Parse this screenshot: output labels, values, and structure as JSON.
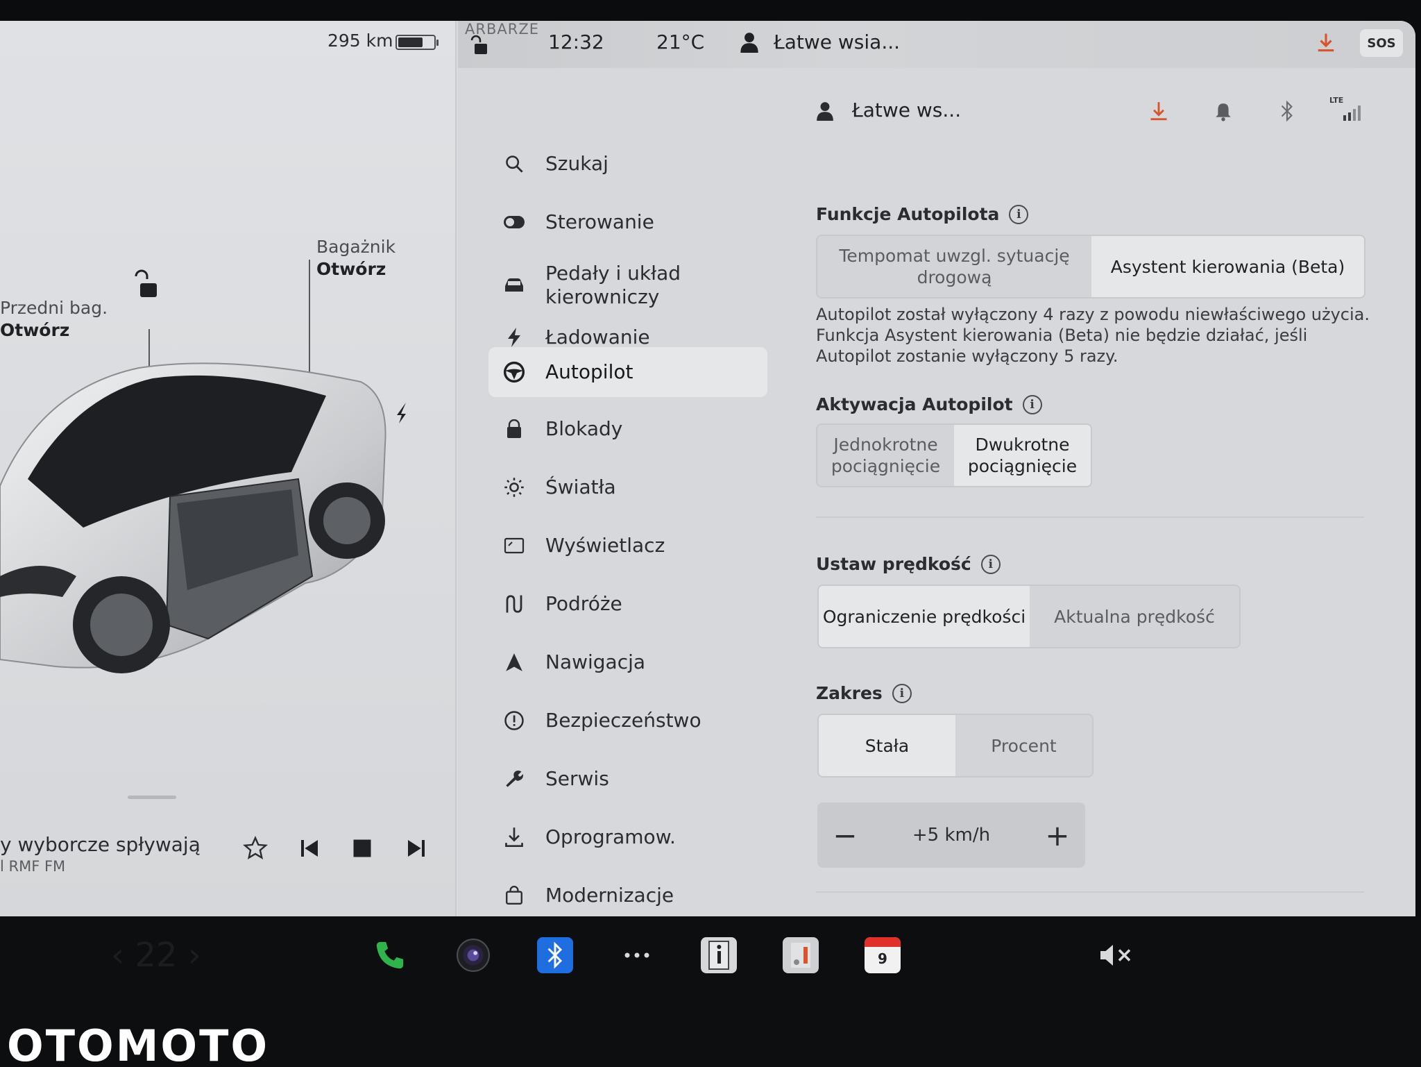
{
  "status": {
    "range": "295 km",
    "battery_level": 0.7,
    "map_label": "ARBARZE",
    "time": "12:32",
    "temperature": "21°C",
    "profile": "Łatwe wsia...",
    "sos_label": "SOS"
  },
  "car": {
    "front_trunk_label": "Przedni bag.",
    "front_trunk_action": "Otwórz",
    "trunk_label": "Bagażnik",
    "trunk_action": "Otwórz"
  },
  "media": {
    "title": "y wyborcze spływają",
    "station": "l RMF FM"
  },
  "nav": {
    "items": [
      {
        "label": "Szukaj",
        "icon": "search-icon"
      },
      {
        "label": "Sterowanie",
        "icon": "toggle-icon"
      },
      {
        "label": "Pedały i układ kierowniczy",
        "icon": "car-icon"
      },
      {
        "label": "Ładowanie",
        "icon": "bolt-icon"
      },
      {
        "label": "Autopilot",
        "icon": "steering-wheel-icon"
      },
      {
        "label": "Blokady",
        "icon": "lock-icon"
      },
      {
        "label": "Światła",
        "icon": "sun-icon"
      },
      {
        "label": "Wyświetlacz",
        "icon": "display-icon"
      },
      {
        "label": "Podróże",
        "icon": "trips-icon"
      },
      {
        "label": "Nawigacja",
        "icon": "navigation-icon"
      },
      {
        "label": "Bezpieczeństwo",
        "icon": "alert-icon"
      },
      {
        "label": "Serwis",
        "icon": "wrench-icon"
      },
      {
        "label": "Oprogramow.",
        "icon": "download-icon"
      },
      {
        "label": "Modernizacje",
        "icon": "bag-icon"
      }
    ],
    "active_index": 4
  },
  "content": {
    "profile_name": "Łatwe ws...",
    "signal_label": "LTE",
    "autopilot_features": {
      "title": "Funkcje Autopilota",
      "options": [
        "Tempomat uwzgl. sytuację drogową",
        "Asystent kierowania (Beta)"
      ],
      "selected": 1
    },
    "warning": "Autopilot został wyłączony 4 razy z powodu niewłaściwego użycia. Funkcja Asystent kierowania (Beta) nie będzie działać, jeśli Autopilot zostanie wyłączony 5 razy.",
    "activation": {
      "title": "Aktywacja Autopilot",
      "options": [
        "Jednokrotne pociągnięcie",
        "Dwukrotne pociągnięcie"
      ],
      "selected": 1
    },
    "set_speed": {
      "title": "Ustaw prędkość",
      "options": [
        "Ograniczenie prędkości",
        "Aktualna prędkość"
      ],
      "selected": 0
    },
    "range": {
      "title": "Zakres",
      "options": [
        "Stała",
        "Procent"
      ],
      "selected": 0
    },
    "offset": {
      "minus": "−",
      "value": "+5 km/h",
      "plus": "+"
    }
  },
  "dock": {
    "calendar_day": "9",
    "watermark": "OTOMOTO"
  },
  "colors": {
    "accent_blue": "#2a5bd7",
    "download_red": "#d9542c",
    "phone_green": "#2fb34a",
    "calendar_red": "#e0302a"
  }
}
